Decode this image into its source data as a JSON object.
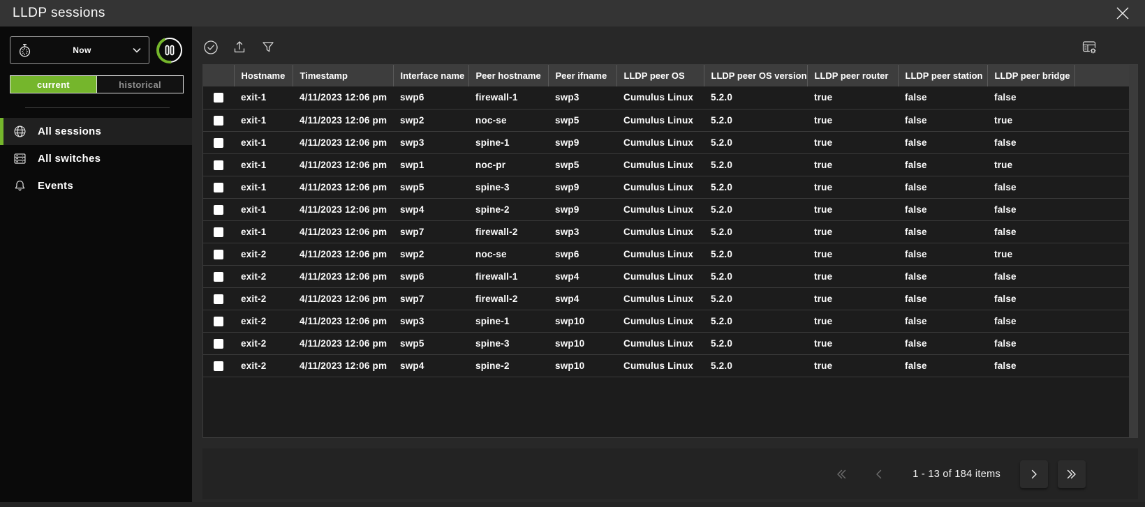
{
  "window": {
    "title": "LLDP sessions",
    "close_icon": "close-icon"
  },
  "colors": {
    "accent_green": "#75b62c",
    "header_bg": "#343434",
    "table_header_bg": "#3d3d3d"
  },
  "sidebar": {
    "time_dropdown": {
      "value": "Now",
      "icon": "stopwatch-icon",
      "chevron": "chevron-down-icon"
    },
    "pause_button": {
      "icon": "pause-icon"
    },
    "view_toggle": {
      "options": [
        "current",
        "historical"
      ],
      "selected": "current"
    },
    "nav_items": [
      {
        "label": "All sessions",
        "icon": "globe-icon",
        "active": true
      },
      {
        "label": "All switches",
        "icon": "switches-icon",
        "active": false
      },
      {
        "label": "Events",
        "icon": "bell-icon",
        "active": false
      }
    ]
  },
  "toolbar": {
    "left_icons": [
      "check-circle-icon",
      "export-icon",
      "filter-icon"
    ],
    "right_icons": [
      "table-settings-icon"
    ]
  },
  "table": {
    "columns": [
      "Hostname",
      "Timestamp",
      "Interface name",
      "Peer hostname",
      "Peer ifname",
      "LLDP peer OS",
      "LLDP peer OS version",
      "LLDP peer router",
      "LLDP peer station",
      "LLDP peer bridge"
    ],
    "rows": [
      [
        "exit-1",
        "4/11/2023 12:06 pm",
        "swp6",
        "firewall-1",
        "swp3",
        "Cumulus Linux",
        "5.2.0",
        "true",
        "false",
        "false"
      ],
      [
        "exit-1",
        "4/11/2023 12:06 pm",
        "swp2",
        "noc-se",
        "swp5",
        "Cumulus Linux",
        "5.2.0",
        "true",
        "false",
        "true"
      ],
      [
        "exit-1",
        "4/11/2023 12:06 pm",
        "swp3",
        "spine-1",
        "swp9",
        "Cumulus Linux",
        "5.2.0",
        "true",
        "false",
        "false"
      ],
      [
        "exit-1",
        "4/11/2023 12:06 pm",
        "swp1",
        "noc-pr",
        "swp5",
        "Cumulus Linux",
        "5.2.0",
        "true",
        "false",
        "true"
      ],
      [
        "exit-1",
        "4/11/2023 12:06 pm",
        "swp5",
        "spine-3",
        "swp9",
        "Cumulus Linux",
        "5.2.0",
        "true",
        "false",
        "false"
      ],
      [
        "exit-1",
        "4/11/2023 12:06 pm",
        "swp4",
        "spine-2",
        "swp9",
        "Cumulus Linux",
        "5.2.0",
        "true",
        "false",
        "false"
      ],
      [
        "exit-1",
        "4/11/2023 12:06 pm",
        "swp7",
        "firewall-2",
        "swp3",
        "Cumulus Linux",
        "5.2.0",
        "true",
        "false",
        "false"
      ],
      [
        "exit-2",
        "4/11/2023 12:06 pm",
        "swp2",
        "noc-se",
        "swp6",
        "Cumulus Linux",
        "5.2.0",
        "true",
        "false",
        "true"
      ],
      [
        "exit-2",
        "4/11/2023 12:06 pm",
        "swp6",
        "firewall-1",
        "swp4",
        "Cumulus Linux",
        "5.2.0",
        "true",
        "false",
        "false"
      ],
      [
        "exit-2",
        "4/11/2023 12:06 pm",
        "swp7",
        "firewall-2",
        "swp4",
        "Cumulus Linux",
        "5.2.0",
        "true",
        "false",
        "false"
      ],
      [
        "exit-2",
        "4/11/2023 12:06 pm",
        "swp3",
        "spine-1",
        "swp10",
        "Cumulus Linux",
        "5.2.0",
        "true",
        "false",
        "false"
      ],
      [
        "exit-2",
        "4/11/2023 12:06 pm",
        "swp5",
        "spine-3",
        "swp10",
        "Cumulus Linux",
        "5.2.0",
        "true",
        "false",
        "false"
      ],
      [
        "exit-2",
        "4/11/2023 12:06 pm",
        "swp4",
        "spine-2",
        "swp10",
        "Cumulus Linux",
        "5.2.0",
        "true",
        "false",
        "false"
      ]
    ]
  },
  "pagination": {
    "range_label": "1 - 13 of 184 items",
    "controls": [
      "first-page-icon",
      "previous-page-icon",
      "next-page-icon",
      "last-page-icon"
    ]
  }
}
